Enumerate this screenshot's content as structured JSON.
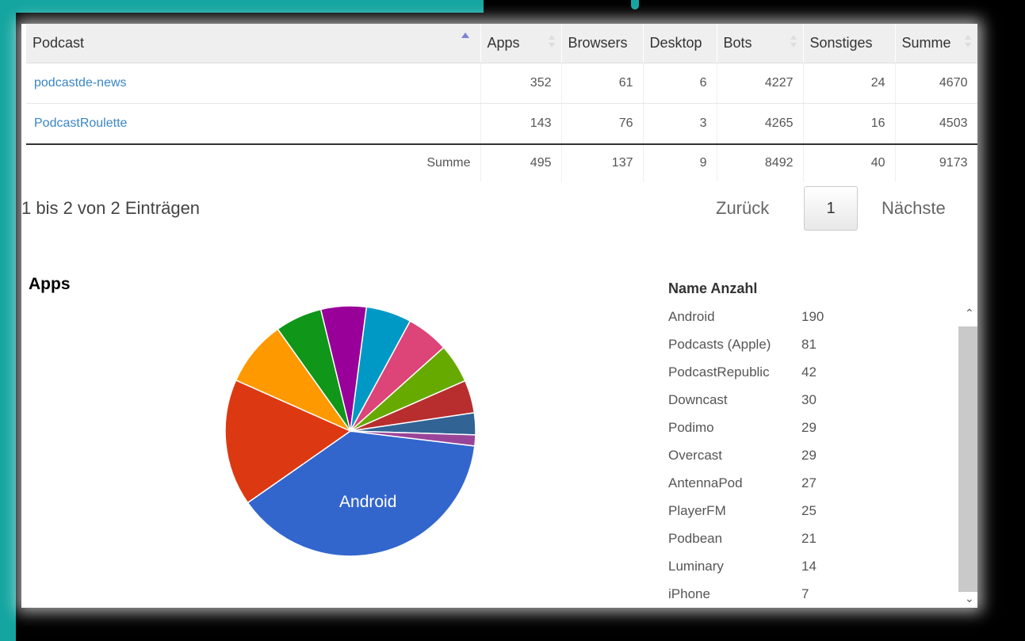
{
  "table": {
    "columns": [
      "Podcast",
      "Apps",
      "Browsers",
      "Desktop",
      "Bots",
      "Sonstiges",
      "Summe"
    ],
    "rows": [
      [
        "podcastde-news",
        "352",
        "61",
        "6",
        "4227",
        "24",
        "4670"
      ],
      [
        "PodcastRoulette",
        "143",
        "76",
        "3",
        "4265",
        "16",
        "4503"
      ]
    ],
    "footer": [
      "Summe",
      "495",
      "137",
      "9",
      "8492",
      "40",
      "9173"
    ]
  },
  "pagination": {
    "info": "1 bis 2 von 2 Einträgen",
    "prev": "Zurück",
    "page": "1",
    "next": "Nächste"
  },
  "chart_data": {
    "type": "pie",
    "title": "Apps",
    "slice_label": "Android",
    "legend_header": "Name Anzahl",
    "slices": [
      {
        "name": "Android",
        "value": 190,
        "color": "#3366cc"
      },
      {
        "name": "Podcasts (Apple)",
        "value": 81,
        "color": "#dc3912"
      },
      {
        "name": "PodcastRepublic",
        "value": 42,
        "color": "#ff9900"
      },
      {
        "name": "Downcast",
        "value": 30,
        "color": "#109618"
      },
      {
        "name": "Podimo",
        "value": 29,
        "color": "#990099"
      },
      {
        "name": "Overcast",
        "value": 29,
        "color": "#0099c6"
      },
      {
        "name": "AntennaPod",
        "value": 27,
        "color": "#dd4477"
      },
      {
        "name": "PlayerFM",
        "value": 25,
        "color": "#66aa00"
      },
      {
        "name": "Podbean",
        "value": 21,
        "color": "#b82e2e"
      },
      {
        "name": "Luminary",
        "value": 14,
        "color": "#316395"
      },
      {
        "name": "iPhone",
        "value": 7,
        "color": "#994499"
      }
    ]
  }
}
